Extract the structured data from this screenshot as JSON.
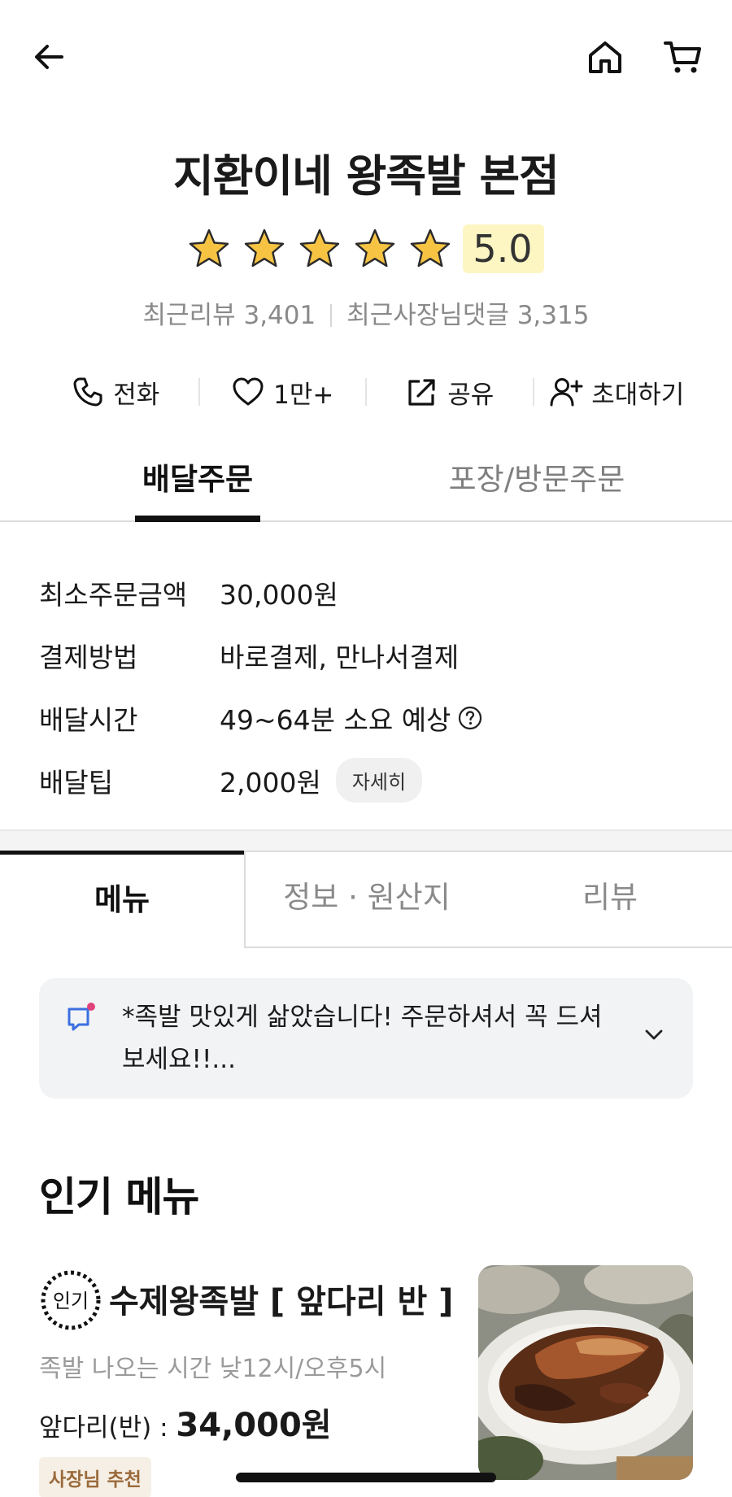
{
  "store": {
    "name": "지환이네 왕족발 본점",
    "rating": "5.0",
    "rating_stars": 5,
    "recent_reviews": "최근리뷰 3,401",
    "recent_owner_replies": "최근사장님댓글 3,315"
  },
  "actions": {
    "call": "전화",
    "like": "1만+",
    "share": "공유",
    "invite": "초대하기"
  },
  "order_tabs": {
    "delivery": "배달주문",
    "pickup": "포장/방문주문"
  },
  "info": {
    "min_order_label": "최소주문금액",
    "min_order_value": "30,000원",
    "payment_label": "결제방법",
    "payment_value": "바로결제, 만나서결제",
    "delivery_time_label": "배달시간",
    "delivery_time_value": "49~64분 소요 예상",
    "delivery_tip_label": "배달팁",
    "delivery_tip_value": "2,000원",
    "detail_button": "자세히"
  },
  "menu_tabs": {
    "menu": "메뉴",
    "info": "정보 · 원산지",
    "review": "리뷰"
  },
  "notice": {
    "text": "*족발 맛있게 삶았습니다! 주문하셔서 꼭 드셔보세요!!..."
  },
  "popular": {
    "title": "인기 메뉴",
    "items": [
      {
        "badge": "인기",
        "name": "수제왕족발  [ 앞다리 반 ]",
        "desc": "족발 나오는 시간 낮12시/오후5시",
        "price_prefix": "앞다리(반) : ",
        "price": "34,000원",
        "tag": "사장님 추천"
      }
    ]
  },
  "colors": {
    "star_fill": "#f6c343",
    "rating_highlight": "#fdf6c3",
    "notice_icon": "#3b6fe0",
    "notice_dot": "#e0437a",
    "owner_badge_text": "#9a6a3a"
  }
}
